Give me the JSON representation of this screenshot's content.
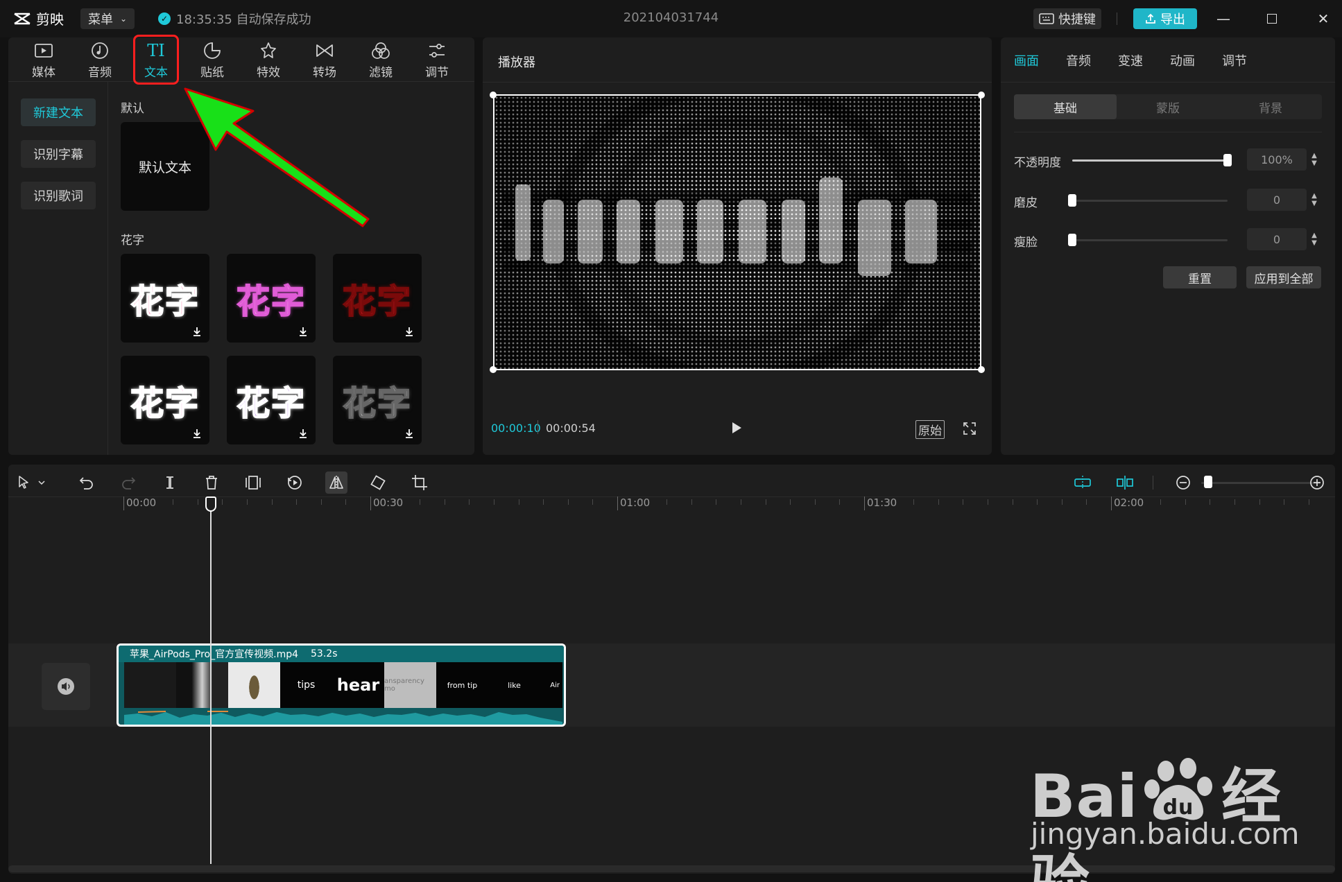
{
  "titlebar": {
    "app_name": "剪映",
    "menu_label": "菜单",
    "autosave_text": "18:35:35 自动保存成功",
    "project_title": "202104031744",
    "shortcut_label": "快捷键",
    "export_label": "导出"
  },
  "tool_tabs": [
    {
      "label": "媒体",
      "icon": "media-icon"
    },
    {
      "label": "音频",
      "icon": "audio-icon"
    },
    {
      "label": "文本",
      "icon": "text-icon",
      "active": true
    },
    {
      "label": "贴纸",
      "icon": "sticker-icon"
    },
    {
      "label": "特效",
      "icon": "effects-icon"
    },
    {
      "label": "转场",
      "icon": "transition-icon"
    },
    {
      "label": "滤镜",
      "icon": "filter-icon"
    },
    {
      "label": "调节",
      "icon": "adjust-icon"
    }
  ],
  "text_sidebar": {
    "items": [
      {
        "label": "新建文本",
        "active": true
      },
      {
        "label": "识别字幕"
      },
      {
        "label": "识别歌词"
      }
    ]
  },
  "text_library": {
    "default_section": "默认",
    "default_item": "默认文本",
    "fancy_section": "花字",
    "fancy_items": [
      {
        "label": "花字",
        "color": "#ff2e7e",
        "outline": "#ffffff"
      },
      {
        "label": "花字",
        "color": "#ffd6f0",
        "outline": "#e05bd6"
      },
      {
        "label": "花字",
        "color": "#e8202a",
        "outline": "#7a0a0a"
      },
      {
        "label": "花字",
        "color": "#ff9ad5",
        "outline": "#ffffff"
      },
      {
        "label": "花字",
        "color": "#a65be8",
        "outline": "#ffffff"
      },
      {
        "label": "花字",
        "color": "#e8e8e8",
        "outline": "#666666"
      }
    ]
  },
  "player": {
    "title": "播放器",
    "current_time": "00:00:10",
    "total_time": "00:00:54",
    "ratio_label": "原始"
  },
  "properties": {
    "tabs": [
      {
        "label": "画面",
        "active": true
      },
      {
        "label": "音频"
      },
      {
        "label": "变速"
      },
      {
        "label": "动画"
      },
      {
        "label": "调节"
      }
    ],
    "segments": [
      {
        "label": "基础",
        "active": true
      },
      {
        "label": "蒙版"
      },
      {
        "label": "背景"
      }
    ],
    "rows": [
      {
        "label": "不透明度",
        "value": "100%",
        "fraction": 1.0
      },
      {
        "label": "磨皮",
        "value": "0",
        "fraction": 0.0
      },
      {
        "label": "瘦脸",
        "value": "0",
        "fraction": 0.0
      }
    ],
    "reset_label": "重置",
    "apply_all_label": "应用到全部"
  },
  "timeline": {
    "ruler": [
      "00:00",
      "00:30",
      "01:00",
      "01:30",
      "02:00"
    ],
    "zoom_fraction": 0.0,
    "clip": {
      "name": "苹果_AirPods_Pro_官方宣传视频.mp4",
      "duration": "53.2s",
      "thumb_texts": [
        "",
        "",
        "",
        "tips",
        "hear",
        "ansparency mo",
        "from tip",
        "like",
        "Air"
      ]
    }
  },
  "watermark": {
    "brand": "Bai",
    "brand_cn": "经验",
    "url": "jingyan.baidu.com"
  },
  "colors": {
    "accent": "#1fc9d9",
    "annotation_red": "#ff1f1f",
    "annotation_green": "#18e018"
  }
}
